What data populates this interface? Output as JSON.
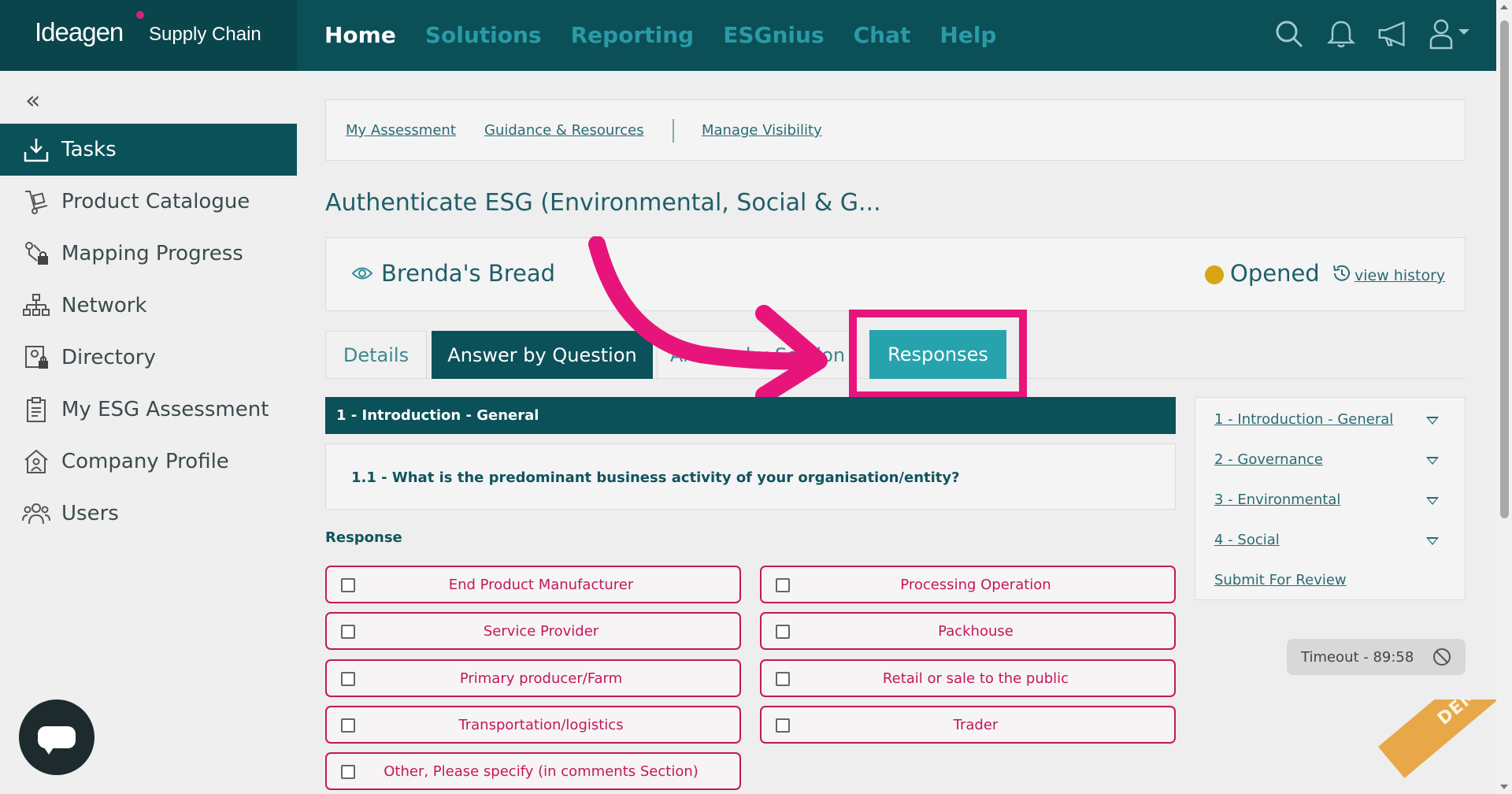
{
  "brand": {
    "name": "Ideagen",
    "product": "Supply Chain"
  },
  "nav": [
    "Home",
    "Solutions",
    "Reporting",
    "ESGnius",
    "Chat",
    "Help"
  ],
  "sidebar": {
    "items": [
      {
        "label": "Tasks",
        "icon": "download-tray-icon"
      },
      {
        "label": "Product Catalogue",
        "icon": "trolley-icon"
      },
      {
        "label": "Mapping Progress",
        "icon": "mapping-lock-icon"
      },
      {
        "label": "Network",
        "icon": "network-icon"
      },
      {
        "label": "Directory",
        "icon": "directory-lock-icon"
      },
      {
        "label": "My ESG Assessment",
        "icon": "clipboard-icon"
      },
      {
        "label": "Company Profile",
        "icon": "house-user-icon"
      },
      {
        "label": "Users",
        "icon": "users-icon"
      }
    ]
  },
  "subnav": {
    "my_assessment": "My Assessment",
    "guidance": "Guidance & Resources",
    "manage_visibility": "Manage Visibility"
  },
  "page_title": "Authenticate ESG (Environmental, Social & G...",
  "org": {
    "name": "Brenda's Bread",
    "status": "Opened",
    "history_link": "view history",
    "status_color": "#d9a514"
  },
  "tabs": {
    "details": "Details",
    "answer_by_question": "Answer by Question",
    "answer_by_section": "Answer by Section",
    "responses": "Responses"
  },
  "section_header": "1 - Introduction - General",
  "question": "1.1 - What is the predominant business activity of your organisation/entity?",
  "response_label": "Response",
  "options": [
    "End Product Manufacturer",
    "Processing Operation",
    "Service Provider",
    "Packhouse",
    "Primary producer/Farm",
    "Retail or sale to the public",
    "Transportation/logistics",
    "Trader",
    "Other, Please specify (in comments Section)"
  ],
  "outline": {
    "items": [
      "1 - Introduction - General",
      "2 - Governance",
      "3 - Environmental",
      "4 - Social"
    ],
    "submit": "Submit For Review"
  },
  "timeout": "Timeout - 89:58",
  "demo": "DEMO",
  "colors": {
    "header": "#0b4f57",
    "accent": "#27a3ae",
    "highlight": "#e7157b",
    "option": "#c2185b"
  }
}
